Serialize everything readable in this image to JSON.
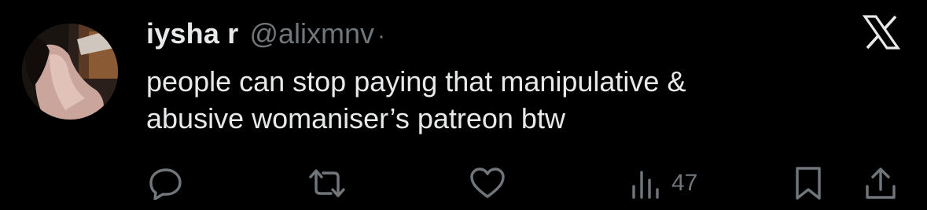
{
  "tweet": {
    "author": {
      "display_name": "iysha r",
      "handle": "@alixmnv",
      "separator": "·"
    },
    "text": "people can stop paying that manipulative &\nabusive womaniser’s patreon btw",
    "metrics": {
      "views": "47"
    }
  },
  "icons": {
    "brand": "x-logo-icon",
    "reply": "reply-icon",
    "repost": "repost-icon",
    "like": "like-icon",
    "views": "views-icon",
    "bookmark": "bookmark-icon",
    "share": "share-icon"
  },
  "colors": {
    "background": "#000000",
    "primary_text": "#e7e9ea",
    "secondary_text": "#71767b"
  }
}
